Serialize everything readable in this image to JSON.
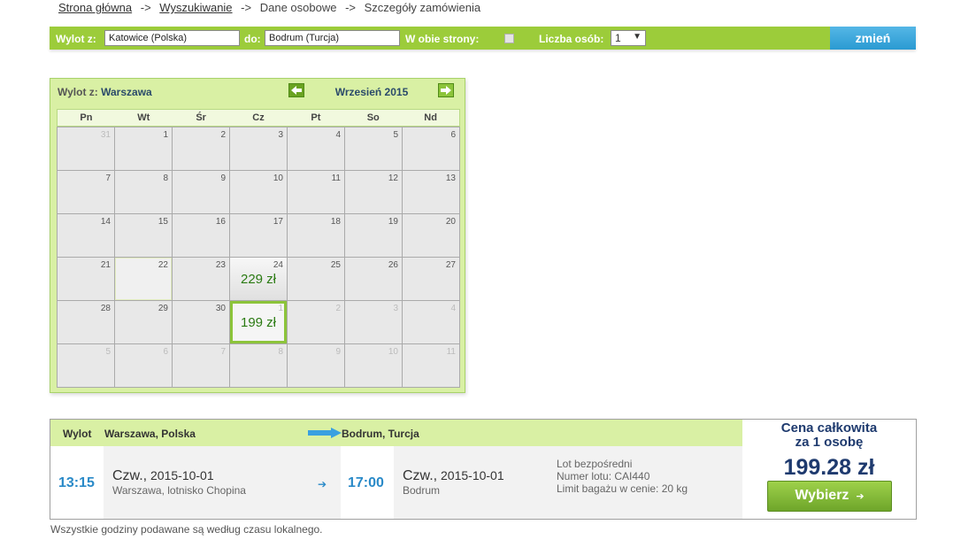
{
  "breadcrumb": {
    "home": "Strona główna",
    "search": "Wyszukiwanie",
    "personal": "Dane osobowe",
    "order": "Szczegóły zamówienia",
    "separator": "->"
  },
  "search": {
    "from_label": "Wylot z:",
    "from_value": "Katowice (Polska)",
    "to_label": "do:",
    "to_value": "Bodrum (Turcja)",
    "both_ways_label": "W obie strony:",
    "persons_label": "Liczba osób:",
    "persons_value": "1",
    "dropdown_arrow": "▼",
    "change_button": "zmień"
  },
  "calendar": {
    "from_label": "Wylot z:",
    "from_city": "Warszawa",
    "month": "Wrzesień 2015",
    "weekdays": [
      "Pn",
      "Wt",
      "Śr",
      "Cz",
      "Pt",
      "So",
      "Nd"
    ],
    "cells": [
      {
        "d": "31",
        "other": true
      },
      {
        "d": "1"
      },
      {
        "d": "2"
      },
      {
        "d": "3"
      },
      {
        "d": "4"
      },
      {
        "d": "5"
      },
      {
        "d": "6"
      },
      {
        "d": "7"
      },
      {
        "d": "8"
      },
      {
        "d": "9"
      },
      {
        "d": "10"
      },
      {
        "d": "11"
      },
      {
        "d": "12"
      },
      {
        "d": "13"
      },
      {
        "d": "14"
      },
      {
        "d": "15"
      },
      {
        "d": "16"
      },
      {
        "d": "17"
      },
      {
        "d": "18"
      },
      {
        "d": "19"
      },
      {
        "d": "20"
      },
      {
        "d": "21"
      },
      {
        "d": "22",
        "hover": true
      },
      {
        "d": "23"
      },
      {
        "d": "24",
        "price": "229 zł"
      },
      {
        "d": "25"
      },
      {
        "d": "26"
      },
      {
        "d": "27"
      },
      {
        "d": "28"
      },
      {
        "d": "29"
      },
      {
        "d": "30"
      },
      {
        "d": "1",
        "other": true,
        "price": "199 zł",
        "selected": true
      },
      {
        "d": "2",
        "other": true
      },
      {
        "d": "3",
        "other": true
      },
      {
        "d": "4",
        "other": true
      },
      {
        "d": "5",
        "other": true
      },
      {
        "d": "6",
        "other": true
      },
      {
        "d": "7",
        "other": true
      },
      {
        "d": "8",
        "other": true
      },
      {
        "d": "9",
        "other": true
      },
      {
        "d": "10",
        "other": true
      },
      {
        "d": "11",
        "other": true
      }
    ]
  },
  "flight": {
    "wylot_label": "Wylot",
    "from_city": "Warszawa, Polska",
    "to_city": "Bodrum, Turcja",
    "dep_time": "13:15",
    "dep_day": "Czw.,",
    "dep_date": "2015-10-01",
    "dep_place": "Warszawa, lotnisko Chopina",
    "arr_time": "17:00",
    "arr_day": "Czw.,",
    "arr_date": "2015-10-01",
    "arr_place": "Bodrum",
    "info_direct": "Lot bezpośredni",
    "info_number": "Numer lotu: CAI440",
    "info_baggage": "Limit bagażu w cenie: 20 kg",
    "small_arrow": "➔"
  },
  "price": {
    "title_line1": "Cena całkowita",
    "title_line2": "za 1 osobę",
    "total": "199.28 zł",
    "select_button": "Wybierz",
    "select_arrow": "➔"
  },
  "footnote": "Wszystkie godziny podawane są według czasu lokalnego.",
  "colors": {
    "accent_green": "#9ccc3a",
    "light_green": "#d9f0a4",
    "time_blue": "#2a8ac8",
    "price_navy": "#1e3a6e",
    "button_blue": "#2a9ad2"
  }
}
